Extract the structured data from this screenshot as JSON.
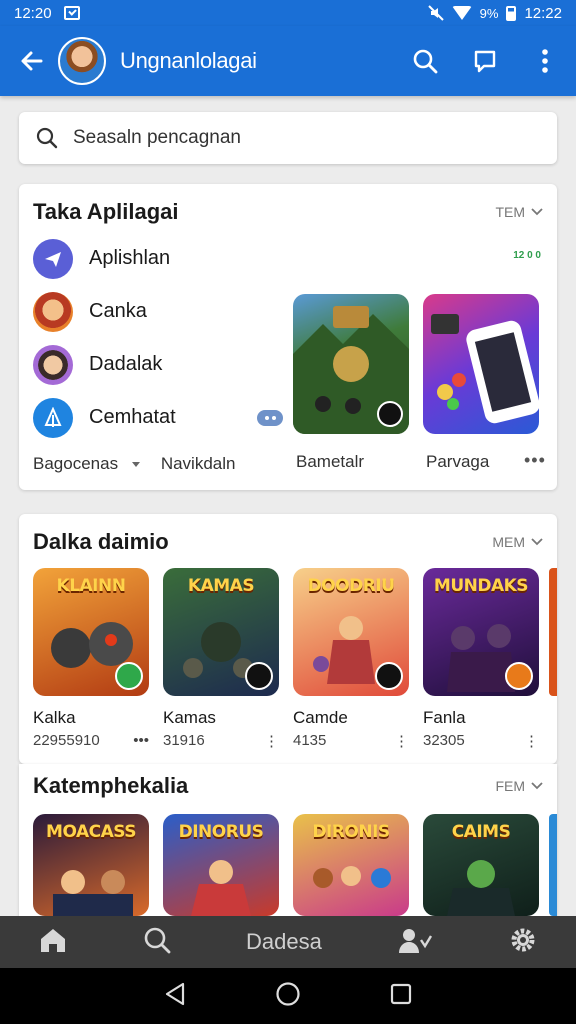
{
  "status_bar": {
    "time_left": "12:20",
    "battery_pct": "9%",
    "time_right": "12:22"
  },
  "app_bar": {
    "title": "Ungnanlolagai"
  },
  "search": {
    "placeholder": "Seasaln pencagnan"
  },
  "top_apps": {
    "title": "Taka Aplilagai",
    "more_label": "TEM",
    "green_tag": "12 0 0",
    "items": [
      {
        "label": "Aplishlan",
        "icon": "paper-plane-icon"
      },
      {
        "label": "Canka",
        "icon": "character-avatar-icon"
      },
      {
        "label": "Dadalak",
        "icon": "character-avatar-icon"
      },
      {
        "label": "Cemhatat",
        "icon": "tree-icon"
      }
    ],
    "footer_left": "Bagocenas",
    "footer_mid": "Navikdaln",
    "tiles": [
      {
        "label": "Bametalr"
      },
      {
        "label": "Parvaga"
      }
    ]
  },
  "section_games": {
    "title": "Dalka daimio",
    "more_label": "MEM",
    "games": [
      {
        "art_title": "KLAINN",
        "name": "Kalka",
        "count": "22955910",
        "colors": [
          "#f2a33a",
          "#b23b13"
        ]
      },
      {
        "art_title": "KAMAS",
        "name": "Kamas",
        "count": "31916",
        "colors": [
          "#3a6d3a",
          "#1d2a4f"
        ]
      },
      {
        "art_title": "DOODRIU",
        "name": "Camde",
        "count": "4135",
        "colors": [
          "#f7b46a",
          "#e04a3a"
        ]
      },
      {
        "art_title": "MUNDAKS",
        "name": "Fanla",
        "count": "32305",
        "colors": [
          "#6a2a9a",
          "#1f0f3a"
        ]
      }
    ]
  },
  "section_cat": {
    "title": "Katemphekalia",
    "more_label": "FEM",
    "games": [
      {
        "art_title": "MOACASS",
        "colors": [
          "#2a1a3a",
          "#d96a2a"
        ]
      },
      {
        "art_title": "DINORUS",
        "colors": [
          "#2a5ec9",
          "#c93a2a"
        ]
      },
      {
        "art_title": "DIRONIS",
        "colors": [
          "#e9c14a",
          "#c93a8a"
        ]
      },
      {
        "art_title": "CAIMS",
        "colors": [
          "#2a4a3a",
          "#0f1f1a"
        ]
      }
    ]
  },
  "bottom_nav": {
    "center_label": "Dadesa"
  }
}
